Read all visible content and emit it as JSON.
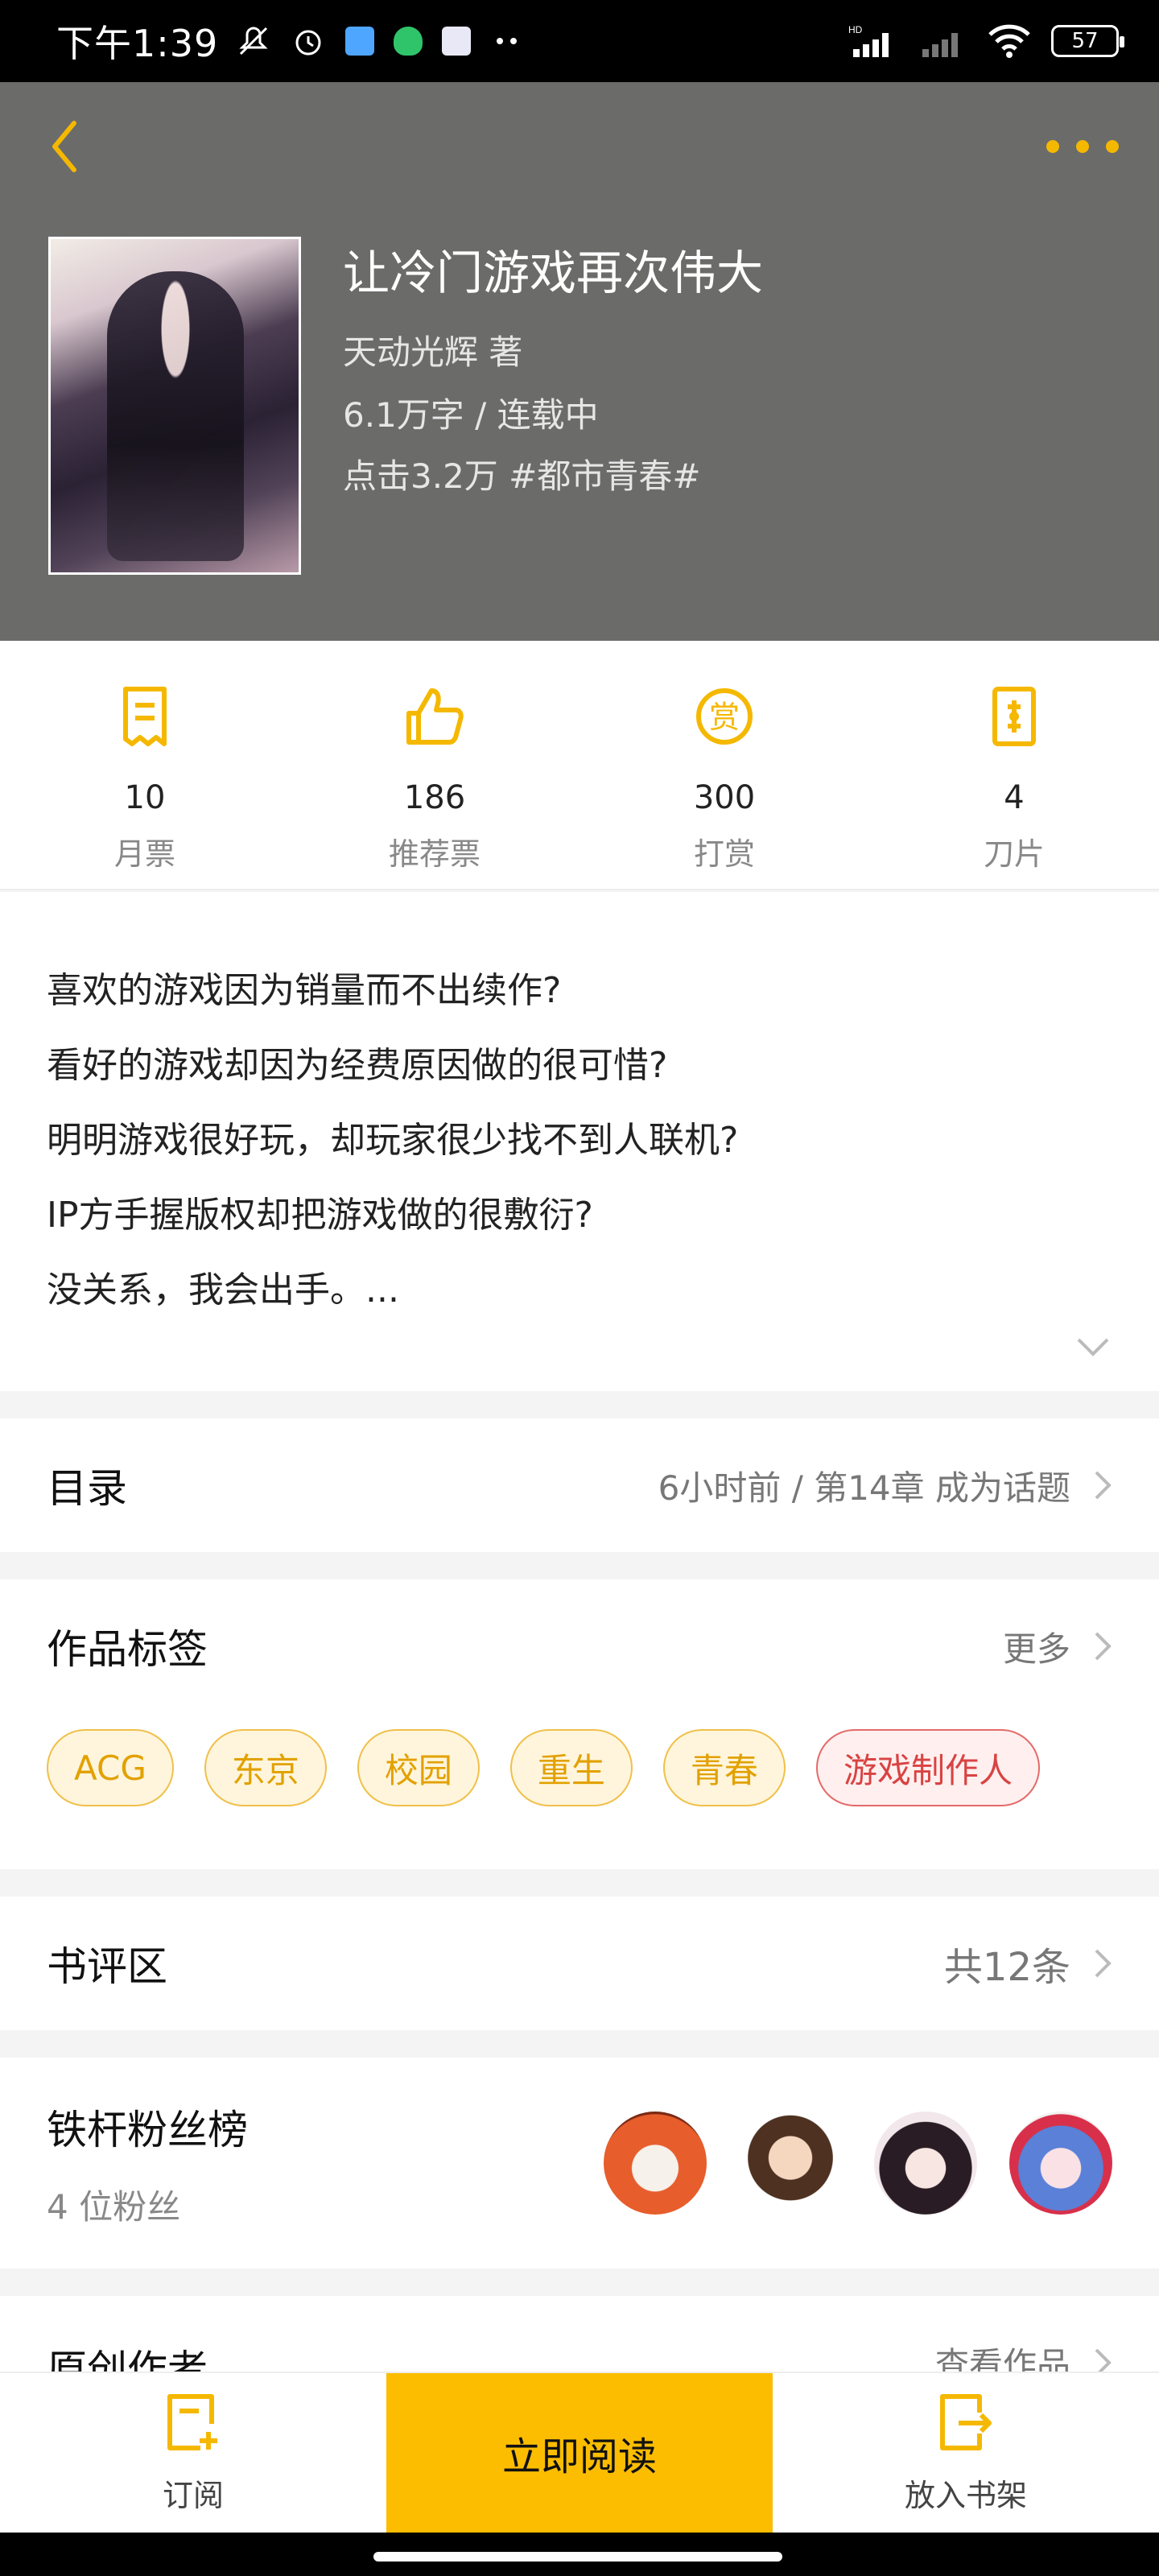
{
  "status_bar": {
    "time": "下午1:39",
    "battery": "57",
    "network_label": "HD"
  },
  "header": {
    "book_title": "让冷门游戏再次伟大",
    "author": "天动光辉  著",
    "words_status": "6.1万字 / 连载中",
    "clicks_genre": "点击3.2万  #都市青春#"
  },
  "stats": [
    {
      "value": "10",
      "label": "月票",
      "icon": "ticket-icon"
    },
    {
      "value": "186",
      "label": "推荐票",
      "icon": "thumbs-up-icon"
    },
    {
      "value": "300",
      "label": "打赏",
      "icon": "reward-icon"
    },
    {
      "value": "4",
      "label": "刀片",
      "icon": "blade-icon"
    }
  ],
  "description": [
    "喜欢的游戏因为销量而不出续作?",
    "看好的游戏却因为经费原因做的很可惜?",
    "明明游戏很好玩，却玩家很少找不到人联机?",
    "IP方手握版权却把游戏做的很敷衍?",
    "没关系，我会出手。..."
  ],
  "catalog": {
    "title": "目录",
    "latest": "6小时前 / 第14章 成为话题"
  },
  "tags_section": {
    "title": "作品标签",
    "more": "更多",
    "tags": [
      "ACG",
      "东京",
      "校园",
      "重生",
      "青春",
      "游戏制作人"
    ]
  },
  "review": {
    "title": "书评区",
    "count": "共12条"
  },
  "fans": {
    "title": "铁杆粉丝榜",
    "count": "4 位粉丝"
  },
  "author_section": {
    "title": "原创作者",
    "link": "查看作品"
  },
  "bottom_bar": {
    "subscribe": "订阅",
    "read_now": "立即阅读",
    "add_shelf": "放入书架"
  },
  "colors": {
    "accent": "#fcbd00",
    "header_bg": "#6b6b6a",
    "tag_red": "#d94343"
  }
}
